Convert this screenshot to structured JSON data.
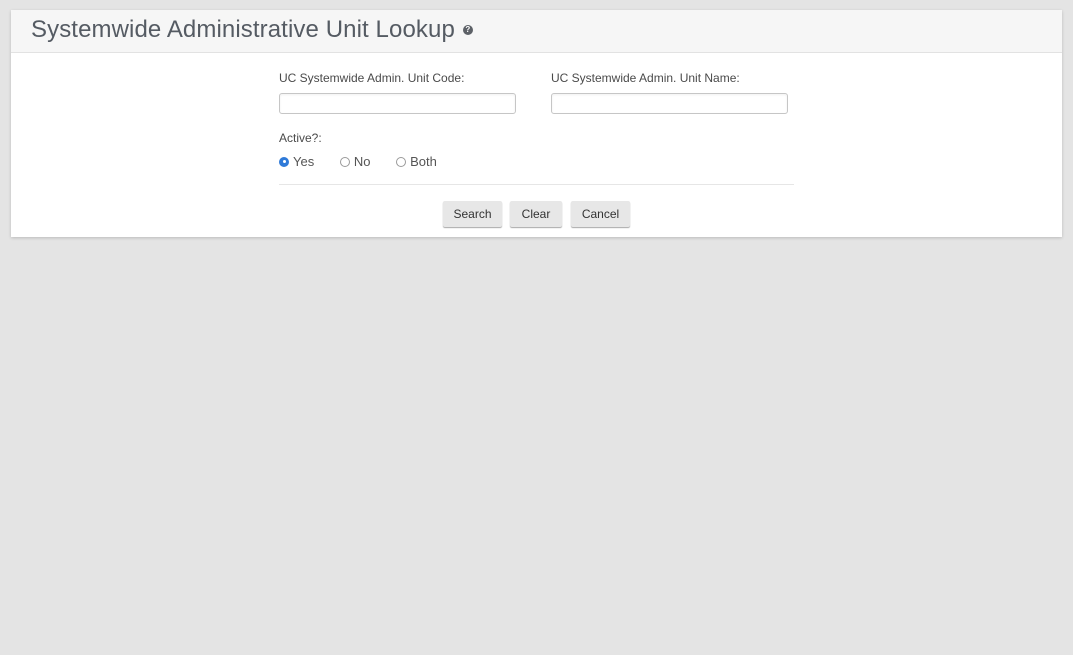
{
  "header": {
    "title": "Systemwide Administrative Unit Lookup",
    "help_icon": "question-circle-icon"
  },
  "form": {
    "code_field": {
      "label": "UC Systemwide Admin. Unit Code:",
      "value": "",
      "placeholder": ""
    },
    "name_field": {
      "label": "UC Systemwide Admin. Unit Name:",
      "value": "",
      "placeholder": ""
    },
    "active": {
      "label": "Active?:",
      "options": [
        "Yes",
        "No",
        "Both"
      ],
      "selected": "Yes"
    }
  },
  "buttons": {
    "search": "Search",
    "clear": "Clear",
    "cancel": "Cancel"
  },
  "colors": {
    "page_background": "#e4e4e4",
    "panel_background": "#ffffff",
    "header_background": "#f6f6f6",
    "radio_selected": "#2f7ad8",
    "button_background": "#e7e7e7"
  }
}
